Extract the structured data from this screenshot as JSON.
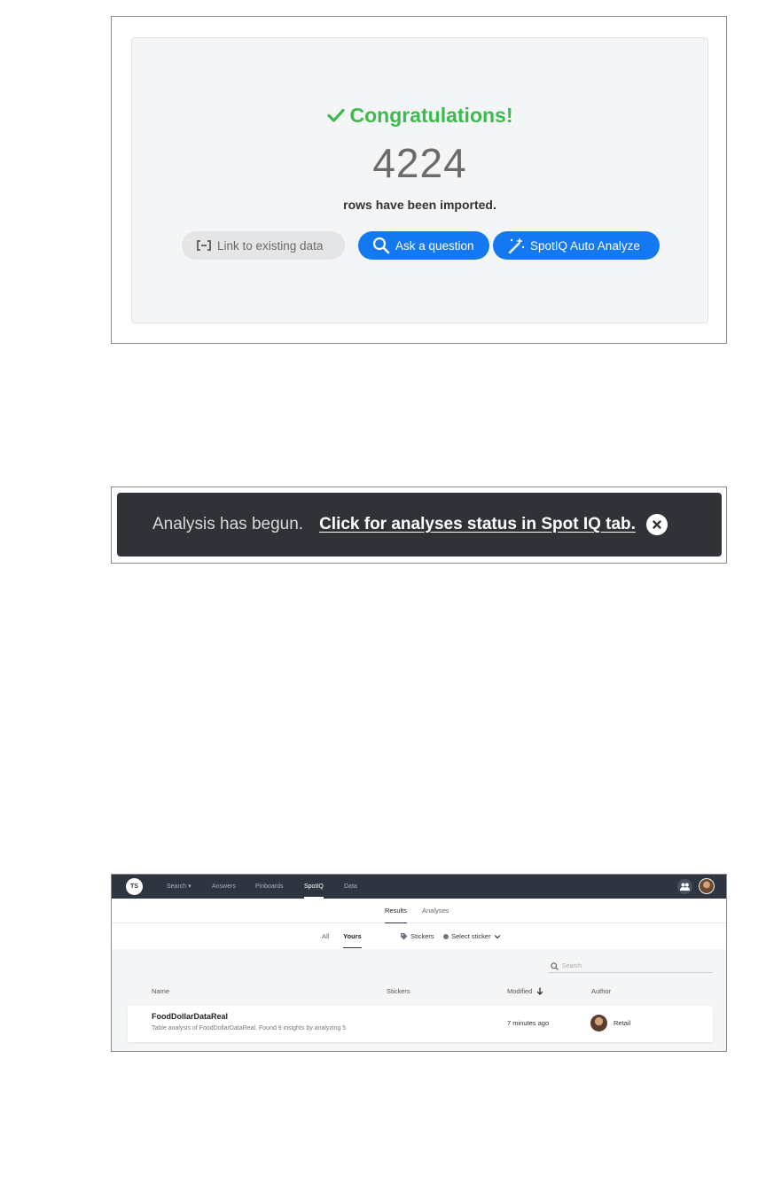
{
  "import_dialog": {
    "title": "Congratulations!",
    "row_count": "4224",
    "subtitle": "rows have been imported.",
    "buttons": {
      "link": "Link to existing data",
      "ask": "Ask a question",
      "spotiq": "SpotIQ Auto Analyze"
    },
    "colors": {
      "success": "#3dba4e",
      "primary": "#1479f0"
    }
  },
  "toast": {
    "message": "Analysis has begun.",
    "link": "Click for analyses status in Spot IQ tab."
  },
  "spotiq": {
    "logo_text": "TS",
    "nav": {
      "search": "Search ▾",
      "answers": "Answers",
      "pinboards": "Pinboards",
      "spotiq": "SpotIQ",
      "data": "Data"
    },
    "subtabs": {
      "results": "Results",
      "analyses": "Analyses"
    },
    "filters": {
      "all": "All",
      "yours": "Yours",
      "stickers": "Stickers",
      "select_sticker": "Select sticker"
    },
    "search_placeholder": "Search",
    "columns": {
      "name": "Name",
      "stickers": "Stickers",
      "modified": "Modified",
      "author": "Author"
    },
    "rows": [
      {
        "name": "FoodDollarDataReal",
        "description": "Table analysis of FoodDollarDataReal. Found 9 insights by analyzing 5",
        "modified": "7 minutes ago",
        "author": "Retail"
      }
    ]
  }
}
